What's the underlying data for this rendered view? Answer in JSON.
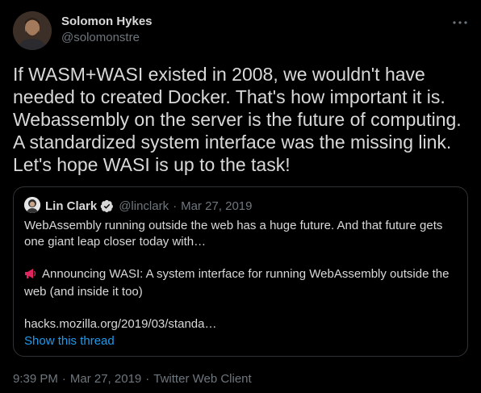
{
  "tweet": {
    "author": {
      "name": "Solomon Hykes",
      "handle": "@solomonstre"
    },
    "text": "If WASM+WASI existed in 2008, we wouldn't have\nneeded to created Docker. That's how important it is.\nWebassembly on the server is the future of computing.\nA standardized system interface was the missing link.\nLet's hope WASI is up to the task!",
    "more_icon": "ellipsis-icon",
    "quote": {
      "author_name": "Lin Clark",
      "verified_icon": "verified-badge-icon",
      "handle": "@linclark",
      "separator": "·",
      "date": "Mar 27, 2019",
      "body_line1": "WebAssembly running outside the web has a huge future. And that future gets one giant leap closer today with…",
      "megaphone_icon": "megaphone-icon",
      "body_line2": "Announcing WASI: A system interface for running WebAssembly outside the web (and inside it too)",
      "link": "hacks.mozilla.org/2019/03/standa…",
      "show_thread": "Show this thread"
    },
    "meta": {
      "time": "9:39 PM",
      "separator": "·",
      "date": "Mar 27, 2019",
      "client": "Twitter Web Client"
    }
  },
  "colors": {
    "background": "#000000",
    "text": "#d9d9d9",
    "secondary_text": "#6e767d",
    "link": "#1d9bf0",
    "border": "#2f3336",
    "verified": "#1d9bf0"
  }
}
